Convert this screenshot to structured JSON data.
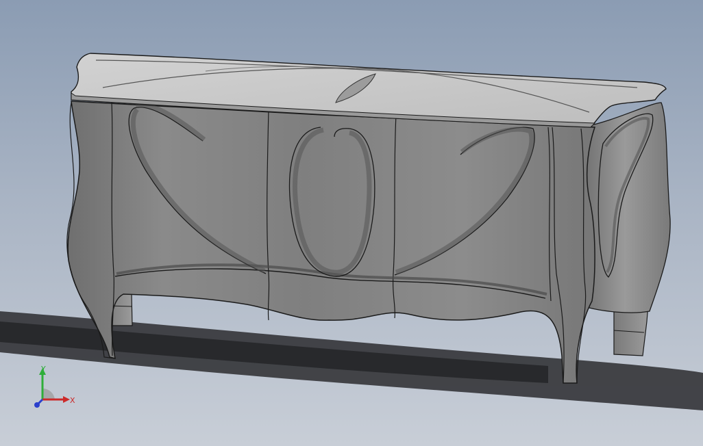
{
  "viewport": {
    "background_top": "#8b9cb3",
    "background_bottom": "#c8ced7"
  },
  "model": {
    "object": "bombe-sideboard",
    "body_color": "#8f8f8f",
    "top_color": "#c9c9c9",
    "edge_color": "#1a1a1a"
  },
  "triad": {
    "x_label": "X",
    "y_label": "Y",
    "x_color": "#cc2a2a",
    "y_color": "#2fae3a",
    "z_color": "#2a3fcc"
  }
}
